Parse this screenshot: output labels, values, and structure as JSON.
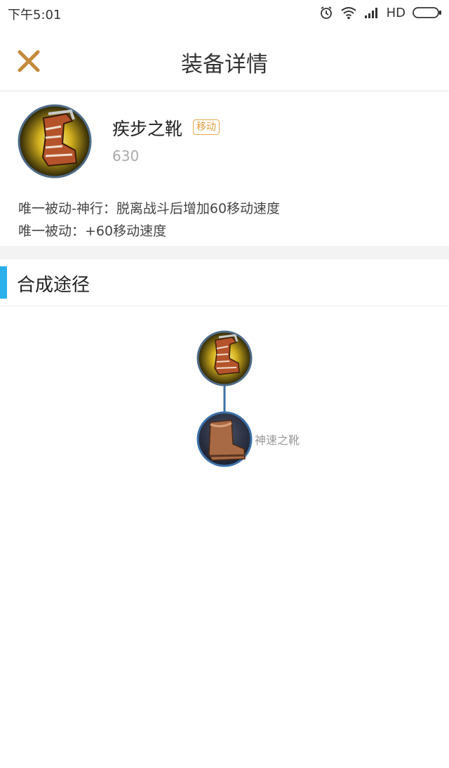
{
  "status_bar": {
    "time": "下午5:01",
    "network": "HD",
    "icons": [
      "alarm-icon",
      "wifi-icon",
      "signal-icon",
      "battery-icon"
    ]
  },
  "nav": {
    "title": "装备详情",
    "close_icon": "close-icon",
    "accent_color": "#c48a3b"
  },
  "item": {
    "name": "疾步之靴",
    "tag": "移动",
    "price": "630",
    "icon": "boots-of-speed-icon",
    "descriptions": [
      "唯一被动-神行：脱离战斗后增加60移动速度",
      "唯一被动：+60移动速度"
    ]
  },
  "recipe": {
    "title": "合成途径",
    "accent_color": "#2ab0ea",
    "tree": {
      "root": {
        "icon": "boots-of-speed-icon"
      },
      "children": [
        {
          "name": "神速之靴",
          "icon": "basic-boots-icon"
        }
      ]
    }
  }
}
